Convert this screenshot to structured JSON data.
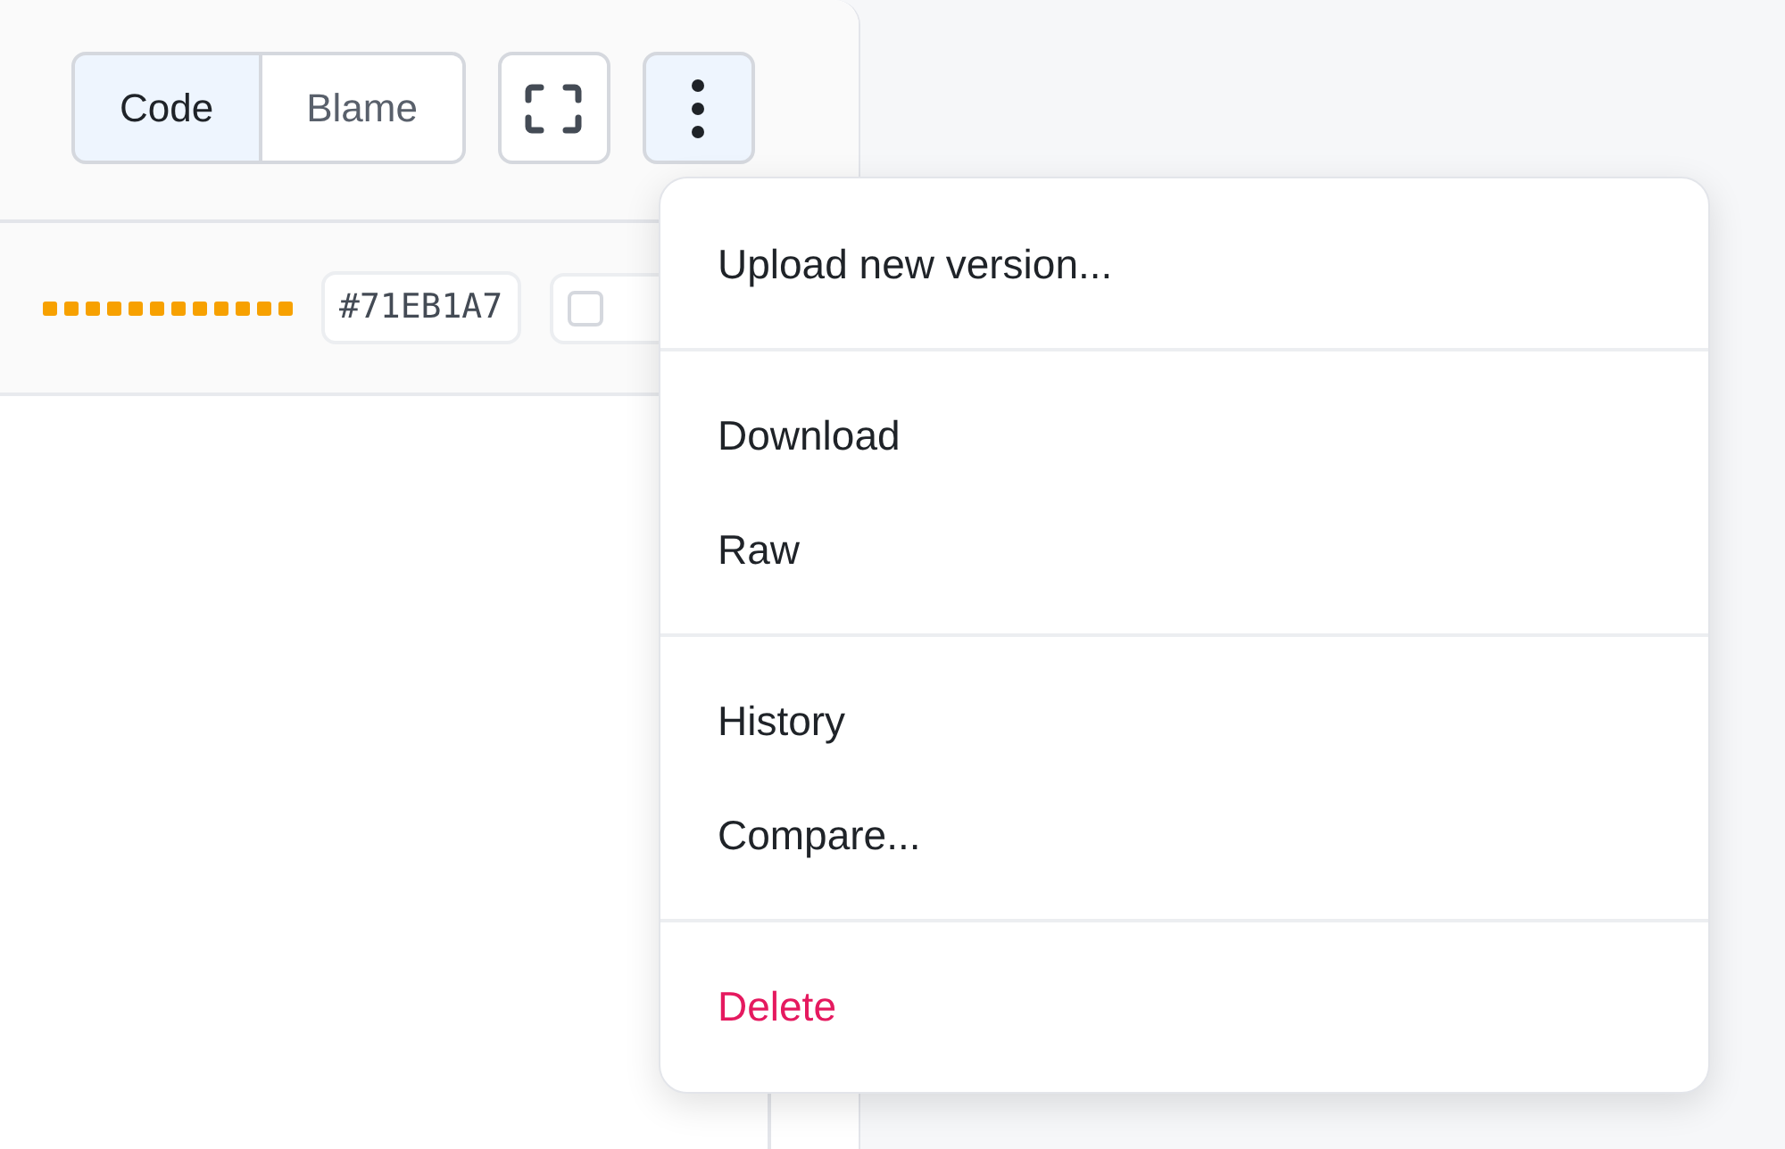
{
  "view_tabs": [
    {
      "label": "Code",
      "selected": true
    },
    {
      "label": "Blame",
      "selected": false
    }
  ],
  "more_button": {
    "expanded": true
  },
  "commit_hash": "#71EB1A7",
  "checkbox_chip": {
    "checked": false
  },
  "menu": {
    "sections": [
      {
        "items": [
          {
            "label": "Upload new version...",
            "kind": "normal"
          }
        ]
      },
      {
        "items": [
          {
            "label": "Download",
            "kind": "normal"
          },
          {
            "label": "Raw",
            "kind": "normal"
          }
        ]
      },
      {
        "items": [
          {
            "label": "History",
            "kind": "normal"
          },
          {
            "label": "Compare...",
            "kind": "normal"
          }
        ]
      },
      {
        "items": [
          {
            "label": "Delete",
            "kind": "danger"
          }
        ]
      }
    ]
  }
}
